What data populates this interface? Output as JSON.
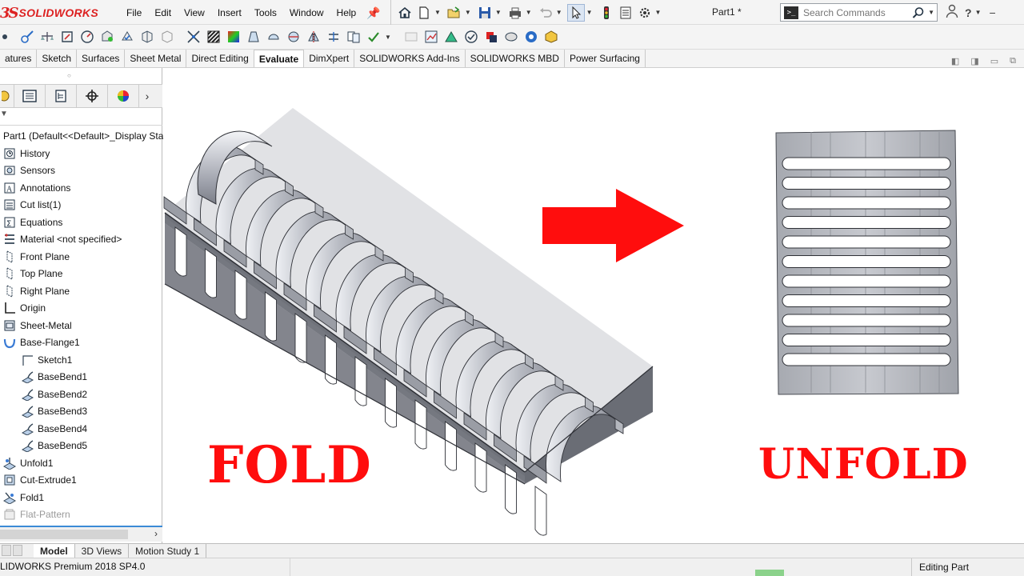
{
  "app": {
    "logo_ds": "3S",
    "logo_name": "SOLIDWORKS",
    "doc_title": "Part1 *"
  },
  "menu": [
    "File",
    "Edit",
    "View",
    "Insert",
    "Tools",
    "Window",
    "Help"
  ],
  "search": {
    "placeholder": "Search Commands"
  },
  "tabs": [
    {
      "label": "atures"
    },
    {
      "label": "Sketch"
    },
    {
      "label": "Surfaces"
    },
    {
      "label": "Sheet Metal"
    },
    {
      "label": "Direct Editing"
    },
    {
      "label": "Evaluate",
      "active": true
    },
    {
      "label": "DimXpert"
    },
    {
      "label": "SOLIDWORKS Add-Ins"
    },
    {
      "label": "SOLIDWORKS MBD"
    },
    {
      "label": "Power Surfacing"
    }
  ],
  "tree": {
    "root": "Part1  (Default<<Default>_Display Sta",
    "items": [
      {
        "label": "History",
        "icon": "history-icon"
      },
      {
        "label": "Sensors",
        "icon": "sensors-icon"
      },
      {
        "label": "Annotations",
        "icon": "annotations-icon"
      },
      {
        "label": "Cut list(1)",
        "icon": "cut-list-icon"
      },
      {
        "label": "Equations",
        "icon": "equations-icon"
      },
      {
        "label": "Material <not specified>",
        "icon": "material-icon"
      },
      {
        "label": "Front Plane",
        "icon": "plane-icon"
      },
      {
        "label": "Top Plane",
        "icon": "plane-icon"
      },
      {
        "label": "Right Plane",
        "icon": "plane-icon"
      },
      {
        "label": "Origin",
        "icon": "origin-icon"
      },
      {
        "label": "Sheet-Metal",
        "icon": "sheet-metal-icon"
      },
      {
        "label": "Base-Flange1",
        "icon": "base-flange-icon"
      },
      {
        "label": "Sketch1",
        "icon": "sketch-icon",
        "indent": 1
      },
      {
        "label": "BaseBend1",
        "icon": "bend-icon",
        "indent": 1
      },
      {
        "label": "BaseBend2",
        "icon": "bend-icon",
        "indent": 1
      },
      {
        "label": "BaseBend3",
        "icon": "bend-icon",
        "indent": 1
      },
      {
        "label": "BaseBend4",
        "icon": "bend-icon",
        "indent": 1
      },
      {
        "label": "BaseBend5",
        "icon": "bend-icon",
        "indent": 1
      },
      {
        "label": "Unfold1",
        "icon": "unfold-icon"
      },
      {
        "label": "Cut-Extrude1",
        "icon": "cut-extrude-icon"
      },
      {
        "label": "Fold1",
        "icon": "fold-icon"
      },
      {
        "label": "Flat-Pattern",
        "icon": "flat-pattern-icon",
        "suppressed": true
      }
    ]
  },
  "bottom_tabs": [
    {
      "label": "Model",
      "active": true
    },
    {
      "label": "3D Views"
    },
    {
      "label": "Motion Study 1"
    }
  ],
  "status": {
    "product": "LIDWORKS Premium 2018 SP4.0",
    "mode": "Editing Part"
  },
  "graphics": {
    "left_caption": "FOLD",
    "right_caption": "UNFOLD",
    "caption_color": "#ff0d0d",
    "arrow_color": "#ff0d0d"
  }
}
